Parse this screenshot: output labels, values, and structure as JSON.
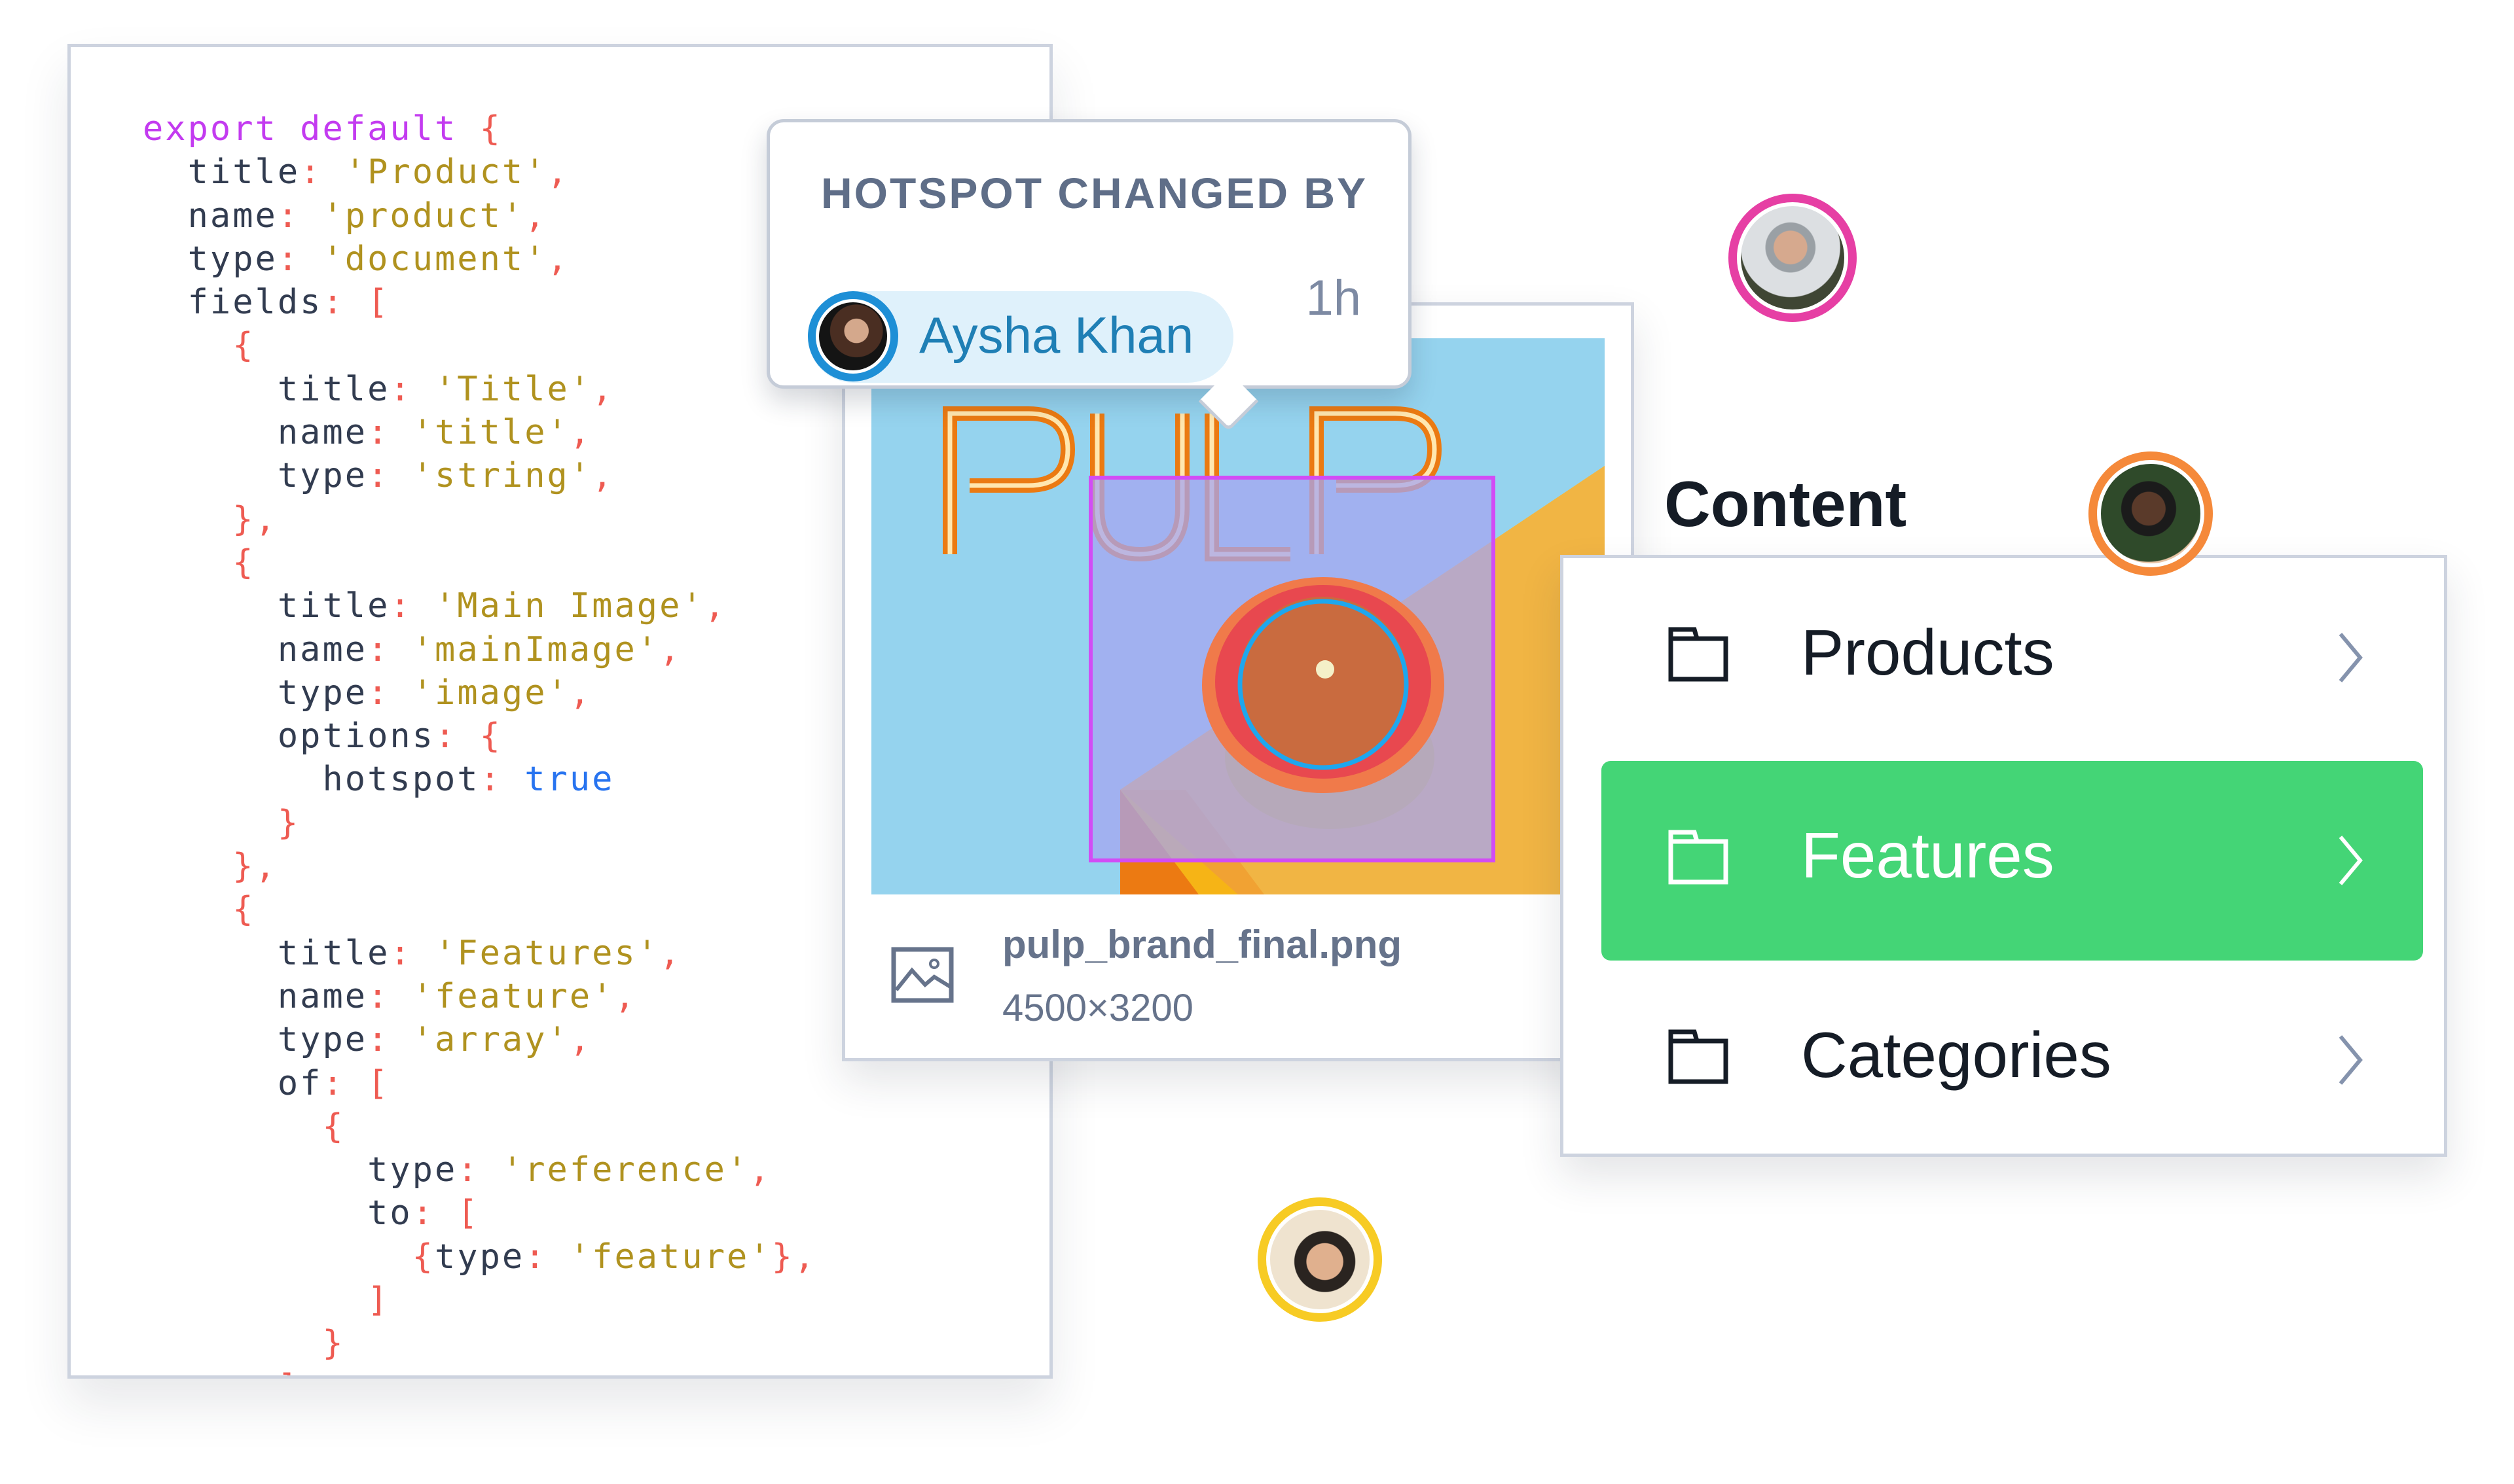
{
  "code_editor": {
    "lines": [
      [
        {
          "t": "kw",
          "v": "export default "
        },
        {
          "t": "punc",
          "v": "{"
        }
      ],
      [
        {
          "t": "key",
          "v": "  title"
        },
        {
          "t": "punc",
          "v": ": "
        },
        {
          "t": "str",
          "v": "'Product'"
        },
        {
          "t": "punc",
          "v": ","
        }
      ],
      [
        {
          "t": "key",
          "v": "  name"
        },
        {
          "t": "punc",
          "v": ": "
        },
        {
          "t": "str",
          "v": "'product'"
        },
        {
          "t": "punc",
          "v": ","
        }
      ],
      [
        {
          "t": "key",
          "v": "  type"
        },
        {
          "t": "punc",
          "v": ": "
        },
        {
          "t": "str",
          "v": "'document'"
        },
        {
          "t": "punc",
          "v": ","
        }
      ],
      [
        {
          "t": "key",
          "v": "  fields"
        },
        {
          "t": "punc",
          "v": ": ["
        }
      ],
      [
        {
          "t": "punc",
          "v": "    {"
        }
      ],
      [
        {
          "t": "key",
          "v": "      title"
        },
        {
          "t": "punc",
          "v": ": "
        },
        {
          "t": "str",
          "v": "'Title'"
        },
        {
          "t": "punc",
          "v": ","
        }
      ],
      [
        {
          "t": "key",
          "v": "      name"
        },
        {
          "t": "punc",
          "v": ": "
        },
        {
          "t": "str",
          "v": "'title'"
        },
        {
          "t": "punc",
          "v": ","
        }
      ],
      [
        {
          "t": "key",
          "v": "      type"
        },
        {
          "t": "punc",
          "v": ": "
        },
        {
          "t": "str",
          "v": "'string'"
        },
        {
          "t": "punc",
          "v": ","
        }
      ],
      [
        {
          "t": "punc",
          "v": "    },"
        }
      ],
      [
        {
          "t": "punc",
          "v": "    {"
        }
      ],
      [
        {
          "t": "key",
          "v": "      title"
        },
        {
          "t": "punc",
          "v": ": "
        },
        {
          "t": "str",
          "v": "'Main Image'"
        },
        {
          "t": "punc",
          "v": ","
        }
      ],
      [
        {
          "t": "key",
          "v": "      name"
        },
        {
          "t": "punc",
          "v": ": "
        },
        {
          "t": "str",
          "v": "'mainImage'"
        },
        {
          "t": "punc",
          "v": ","
        }
      ],
      [
        {
          "t": "key",
          "v": "      type"
        },
        {
          "t": "punc",
          "v": ": "
        },
        {
          "t": "str",
          "v": "'image'"
        },
        {
          "t": "punc",
          "v": ","
        }
      ],
      [
        {
          "t": "key",
          "v": "      options"
        },
        {
          "t": "punc",
          "v": ": {"
        }
      ],
      [
        {
          "t": "key",
          "v": "        hotspot"
        },
        {
          "t": "punc",
          "v": ": "
        },
        {
          "t": "bool",
          "v": "true"
        }
      ],
      [
        {
          "t": "punc",
          "v": "      }"
        }
      ],
      [
        {
          "t": "punc",
          "v": "    },"
        }
      ],
      [
        {
          "t": "punc",
          "v": "    {"
        }
      ],
      [
        {
          "t": "key",
          "v": "      title"
        },
        {
          "t": "punc",
          "v": ": "
        },
        {
          "t": "str",
          "v": "'Features'"
        },
        {
          "t": "punc",
          "v": ","
        }
      ],
      [
        {
          "t": "key",
          "v": "      name"
        },
        {
          "t": "punc",
          "v": ": "
        },
        {
          "t": "str",
          "v": "'feature'"
        },
        {
          "t": "punc",
          "v": ","
        }
      ],
      [
        {
          "t": "key",
          "v": "      type"
        },
        {
          "t": "punc",
          "v": ": "
        },
        {
          "t": "str",
          "v": "'array'"
        },
        {
          "t": "punc",
          "v": ","
        }
      ],
      [
        {
          "t": "key",
          "v": "      of"
        },
        {
          "t": "punc",
          "v": ": ["
        }
      ],
      [
        {
          "t": "punc",
          "v": "        {"
        }
      ],
      [
        {
          "t": "key",
          "v": "          type"
        },
        {
          "t": "punc",
          "v": ": "
        },
        {
          "t": "str",
          "v": "'reference'"
        },
        {
          "t": "punc",
          "v": ","
        }
      ],
      [
        {
          "t": "key",
          "v": "          to"
        },
        {
          "t": "punc",
          "v": ": ["
        }
      ],
      [
        {
          "t": "punc",
          "v": "            {"
        },
        {
          "t": "key",
          "v": "type"
        },
        {
          "t": "punc",
          "v": ": "
        },
        {
          "t": "str",
          "v": "'feature'"
        },
        {
          "t": "punc",
          "v": "},"
        }
      ],
      [
        {
          "t": "punc",
          "v": "          ]"
        }
      ],
      [
        {
          "t": "punc",
          "v": "        }"
        }
      ],
      [
        {
          "t": "punc",
          "v": "      ]"
        }
      ]
    ]
  },
  "tooltip": {
    "heading": "HOTSPOT CHANGED BY",
    "user_name": "Aysha Khan",
    "time_ago": "1h",
    "user_ring_color": "#1e8fd6"
  },
  "image_card": {
    "image_text": "PULP",
    "filename": "pulp_brand_final.png",
    "dimensions": "4500×3200",
    "icon": "image-icon",
    "crop_color": "#d24cf5",
    "hotspot_color": "#1ea7ee"
  },
  "content_panel": {
    "title": "Content",
    "items": [
      {
        "label": "Products",
        "icon": "folder-icon",
        "active": false
      },
      {
        "label": "Features",
        "icon": "folder-icon",
        "active": true
      },
      {
        "label": "Categories",
        "icon": "folder-icon",
        "active": false
      }
    ],
    "accent_color": "#44d576"
  },
  "presence_avatars": [
    {
      "name": "presence-avatar-pink",
      "ring_color": "#e63fa4"
    },
    {
      "name": "presence-avatar-orange",
      "ring_color": "#f5893a"
    },
    {
      "name": "presence-avatar-yellow",
      "ring_color": "#f7cb24"
    }
  ]
}
